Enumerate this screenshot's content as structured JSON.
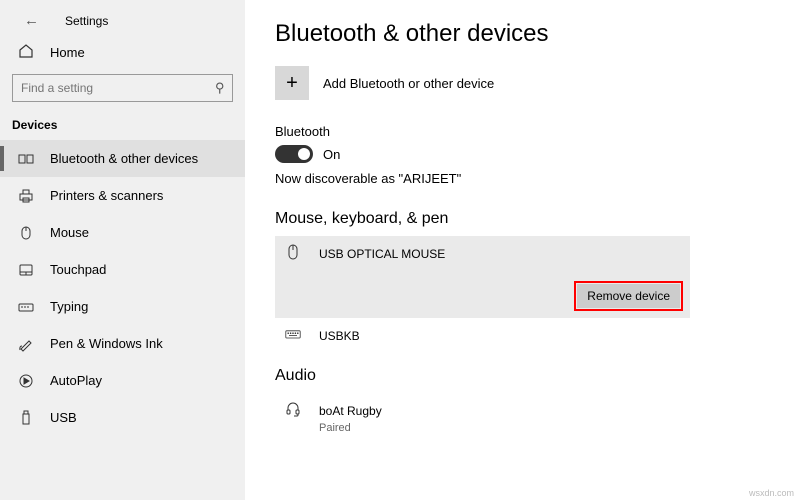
{
  "appTitle": "Settings",
  "home": "Home",
  "searchPlaceholder": "Find a setting",
  "categoryHeader": "Devices",
  "nav": [
    "Bluetooth & other devices",
    "Printers & scanners",
    "Mouse",
    "Touchpad",
    "Typing",
    "Pen & Windows Ink",
    "AutoPlay",
    "USB"
  ],
  "pageTitle": "Bluetooth & other devices",
  "addLabel": "Add Bluetooth or other device",
  "btLabel": "Bluetooth",
  "btState": "On",
  "discoverText": "Now discoverable as \"ARIJEET\"",
  "sectionMouse": "Mouse, keyboard, & pen",
  "devices": {
    "mouse": "USB OPTICAL MOUSE",
    "kb": "USBKB"
  },
  "removeLabel": "Remove device",
  "sectionAudio": "Audio",
  "audioDevice": {
    "name": "boAt Rugby",
    "status": "Paired"
  },
  "watermark": "wsxdn.com"
}
